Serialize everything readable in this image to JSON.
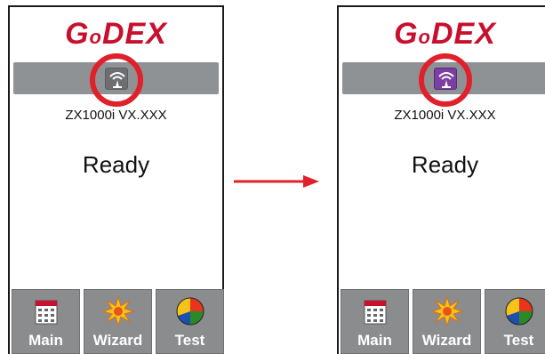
{
  "screens": [
    {
      "logo": {
        "g": "G",
        "o": "o",
        "rest": "DEX"
      },
      "network_icon": "network-icon",
      "network_icon_color": "#6d6e70",
      "model": "ZX1000i VX.XXX",
      "status": "Ready",
      "buttons": [
        {
          "label": "Main",
          "icon": "calendar-icon"
        },
        {
          "label": "Wizard",
          "icon": "wizard-burst-icon"
        },
        {
          "label": "Test",
          "icon": "pie-chart-icon"
        }
      ]
    },
    {
      "logo": {
        "g": "G",
        "o": "o",
        "rest": "DEX"
      },
      "network_icon": "network-icon",
      "network_icon_color": "#7b3fa1",
      "model": "ZX1000i VX.XXX",
      "status": "Ready",
      "buttons": [
        {
          "label": "Main",
          "icon": "calendar-icon"
        },
        {
          "label": "Wizard",
          "icon": "wizard-burst-icon"
        },
        {
          "label": "Test",
          "icon": "pie-chart-icon"
        }
      ]
    }
  ],
  "colors": {
    "logo": "#c8102e",
    "highlight_ring": "#e0202a",
    "arrow": "#e0202a",
    "status_bar": "#8f9294"
  }
}
